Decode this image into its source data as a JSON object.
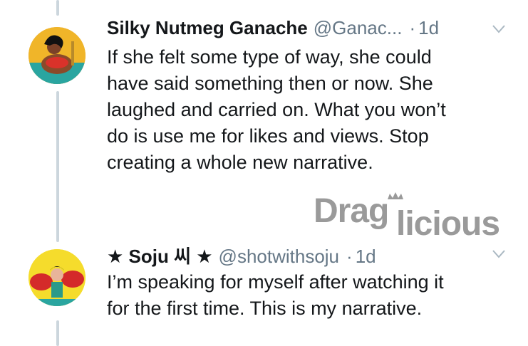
{
  "tweets": [
    {
      "display_name": "Silky Nutmeg Ganache",
      "handle": "@Ganac...",
      "separator": "·",
      "time": "1d",
      "lines": [
        "If she felt some type of way, she could",
        "have said something then or now. She",
        "laughed and carried on. What you won’t",
        "do is use me for likes and views. Stop",
        "creating a whole new narrative."
      ]
    },
    {
      "display_name": "★ Soju 씨 ★",
      "handle": "@shotwithsoju",
      "separator": "·",
      "time": "1d",
      "lines": [
        "I’m speaking for myself after watching it",
        "for the first time. This is my narrative."
      ]
    }
  ],
  "watermark": {
    "text_left": "Drag",
    "text_right": "licious"
  },
  "colors": {
    "text": "#14171a",
    "secondary": "#657786",
    "thread_line": "#ccd6dd"
  },
  "icons": [
    "avatar",
    "chevron-down-icon",
    "crown-icon"
  ]
}
